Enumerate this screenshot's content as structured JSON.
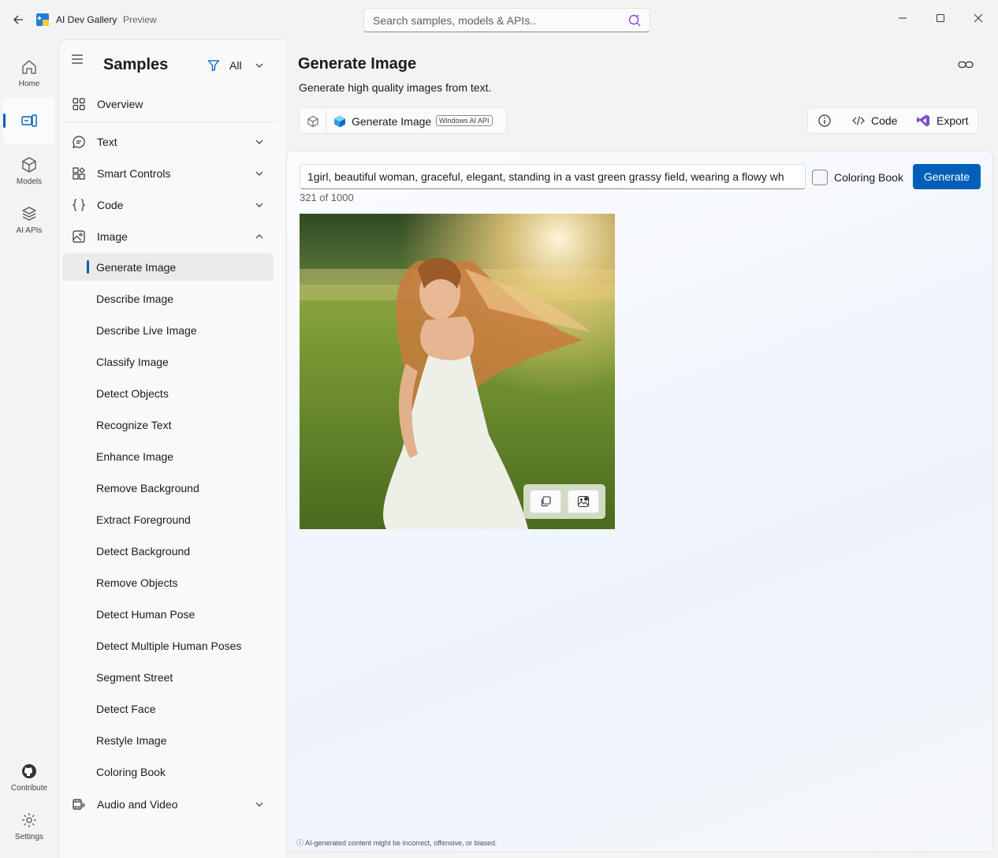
{
  "window": {
    "app_title": "AI Dev Gallery",
    "app_badge": "Preview",
    "search_placeholder": "Search samples, models & APIs.."
  },
  "rail": {
    "items": [
      {
        "label": "Home",
        "icon": "home-icon"
      },
      {
        "label": "",
        "icon": "samples-icon"
      },
      {
        "label": "Models",
        "icon": "cube-icon"
      },
      {
        "label": "AI APIs",
        "icon": "layers-icon"
      }
    ],
    "bottom": [
      {
        "label": "Contribute",
        "icon": "github-icon"
      },
      {
        "label": "Settings",
        "icon": "gear-icon"
      }
    ]
  },
  "samples": {
    "title": "Samples",
    "filter_label": "All",
    "overview": "Overview",
    "categories": [
      {
        "label": "Text",
        "icon": "chat-icon"
      },
      {
        "label": "Smart Controls",
        "icon": "controls-icon"
      },
      {
        "label": "Code",
        "icon": "braces-icon"
      },
      {
        "label": "Image",
        "icon": "image-icon"
      }
    ],
    "image_items": [
      "Generate Image",
      "Describe Image",
      "Describe Live Image",
      "Classify Image",
      "Detect Objects",
      "Recognize Text",
      "Enhance Image",
      "Remove Background",
      "Extract Foreground",
      "Detect Background",
      "Remove Objects",
      "Detect Human Pose",
      "Detect Multiple Human Poses",
      "Segment Street",
      "Detect Face",
      "Restyle Image",
      "Coloring Book"
    ],
    "audio_video": "Audio and Video"
  },
  "main": {
    "title": "Generate Image",
    "subtitle": "Generate high quality images from text.",
    "model_name": "Generate Image",
    "model_badge": "Windows AI API",
    "code_label": "Code",
    "export_label": "Export",
    "prompt_value": "1girl, beautiful woman, graceful, elegant, standing in a vast green grassy field, wearing a flowy wh",
    "counter": "321 of 1000",
    "coloring_book_label": "Coloring Book",
    "generate_label": "Generate",
    "disclaimer": "ⓘ AI-generated content might be incorrect, offensive, or biased."
  },
  "colors": {
    "accent": "#005fb8"
  }
}
